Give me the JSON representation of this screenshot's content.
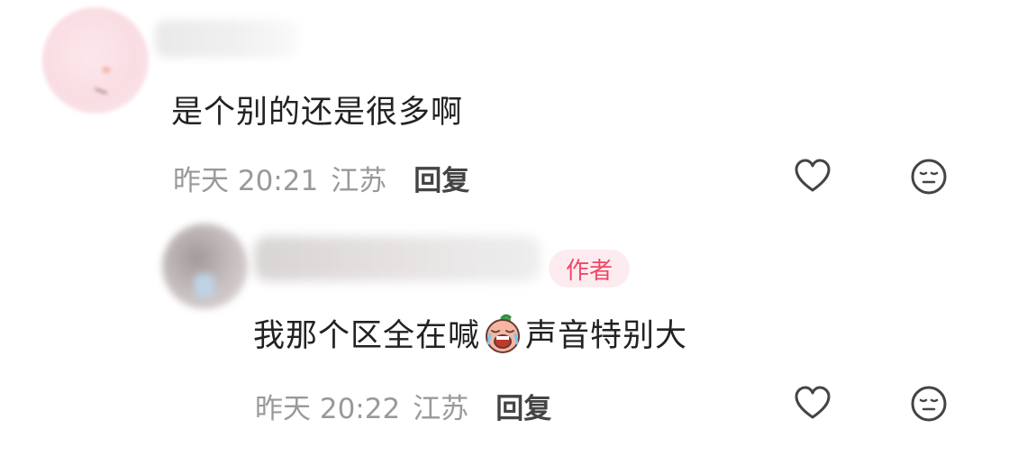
{
  "comments": [
    {
      "text": "是个别的还是很多啊",
      "time": "昨天 20:21",
      "location": "江苏",
      "reply_label": "回复",
      "avatar_icon": "cartoon-avatar",
      "username_blurred": true
    },
    {
      "text_before_emoji": "我那个区全在喊",
      "emoji": "crying-shouting-emoji",
      "text_after_emoji": "声音特别大",
      "badge": "作者",
      "time": "昨天 20:22",
      "location": "江苏",
      "reply_label": "回复",
      "avatar_icon": "photo-avatar",
      "username_blurred": true
    }
  ],
  "icons": {
    "like": "heart-outline-icon",
    "dislike": "neutral-face-icon"
  },
  "colors": {
    "text_primary": "#222222",
    "text_meta": "#999999",
    "reply": "#444444",
    "badge_text": "#f04867",
    "badge_bg": "#fdecef",
    "icon_stroke": "#444444"
  }
}
